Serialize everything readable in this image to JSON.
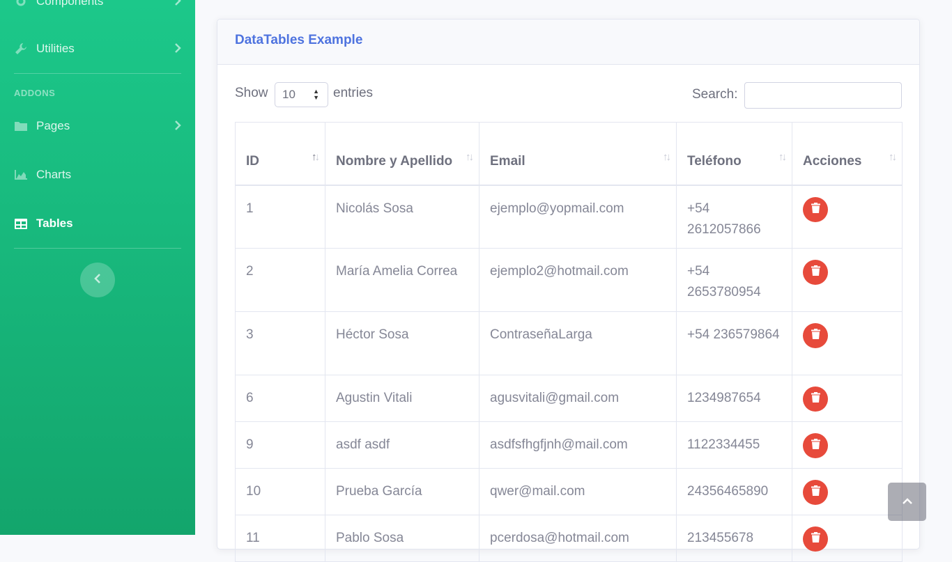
{
  "sidebar": {
    "components_label": "Components",
    "utilities_label": "Utilities",
    "heading": "ADDONS",
    "pages_label": "Pages",
    "charts_label": "Charts",
    "tables_label": "Tables"
  },
  "card": {
    "title": "DataTables Example"
  },
  "controls": {
    "show_label": "Show",
    "entries_value": "10",
    "entries_label": "entries",
    "search_label": "Search:",
    "search_value": ""
  },
  "table": {
    "headers": [
      "ID",
      "Nombre y Apellido",
      "Email",
      "Teléfono",
      "Acciones"
    ],
    "rows": [
      {
        "id": "1",
        "name": "Nicolás Sosa",
        "email": "ejemplo@yopmail.com",
        "phone": "+54 2612057866"
      },
      {
        "id": "2",
        "name": "María Amelia Correa",
        "email": "ejemplo2@hotmail.com",
        "phone": "+54 2653780954"
      },
      {
        "id": "3",
        "name": "Héctor Sosa",
        "email": "ContraseñaLarga",
        "phone": "+54 236579864"
      },
      {
        "id": "6",
        "name": "Agustin Vitali",
        "email": "agusvitali@gmail.com",
        "phone": "1234987654"
      },
      {
        "id": "9",
        "name": "asdf asdf",
        "email": "asdfsfhgfjnh@mail.com",
        "phone": "1122334455"
      },
      {
        "id": "10",
        "name": "Prueba García",
        "email": "qwer@mail.com",
        "phone": "24356465890"
      },
      {
        "id": "11",
        "name": "Pablo Sosa",
        "email": "pcerdosa@hotmail.com",
        "phone": "213455678"
      }
    ]
  },
  "colors": {
    "sidebar": "#1cc88a",
    "primary": "#4e73df",
    "danger": "#e74a3b"
  }
}
